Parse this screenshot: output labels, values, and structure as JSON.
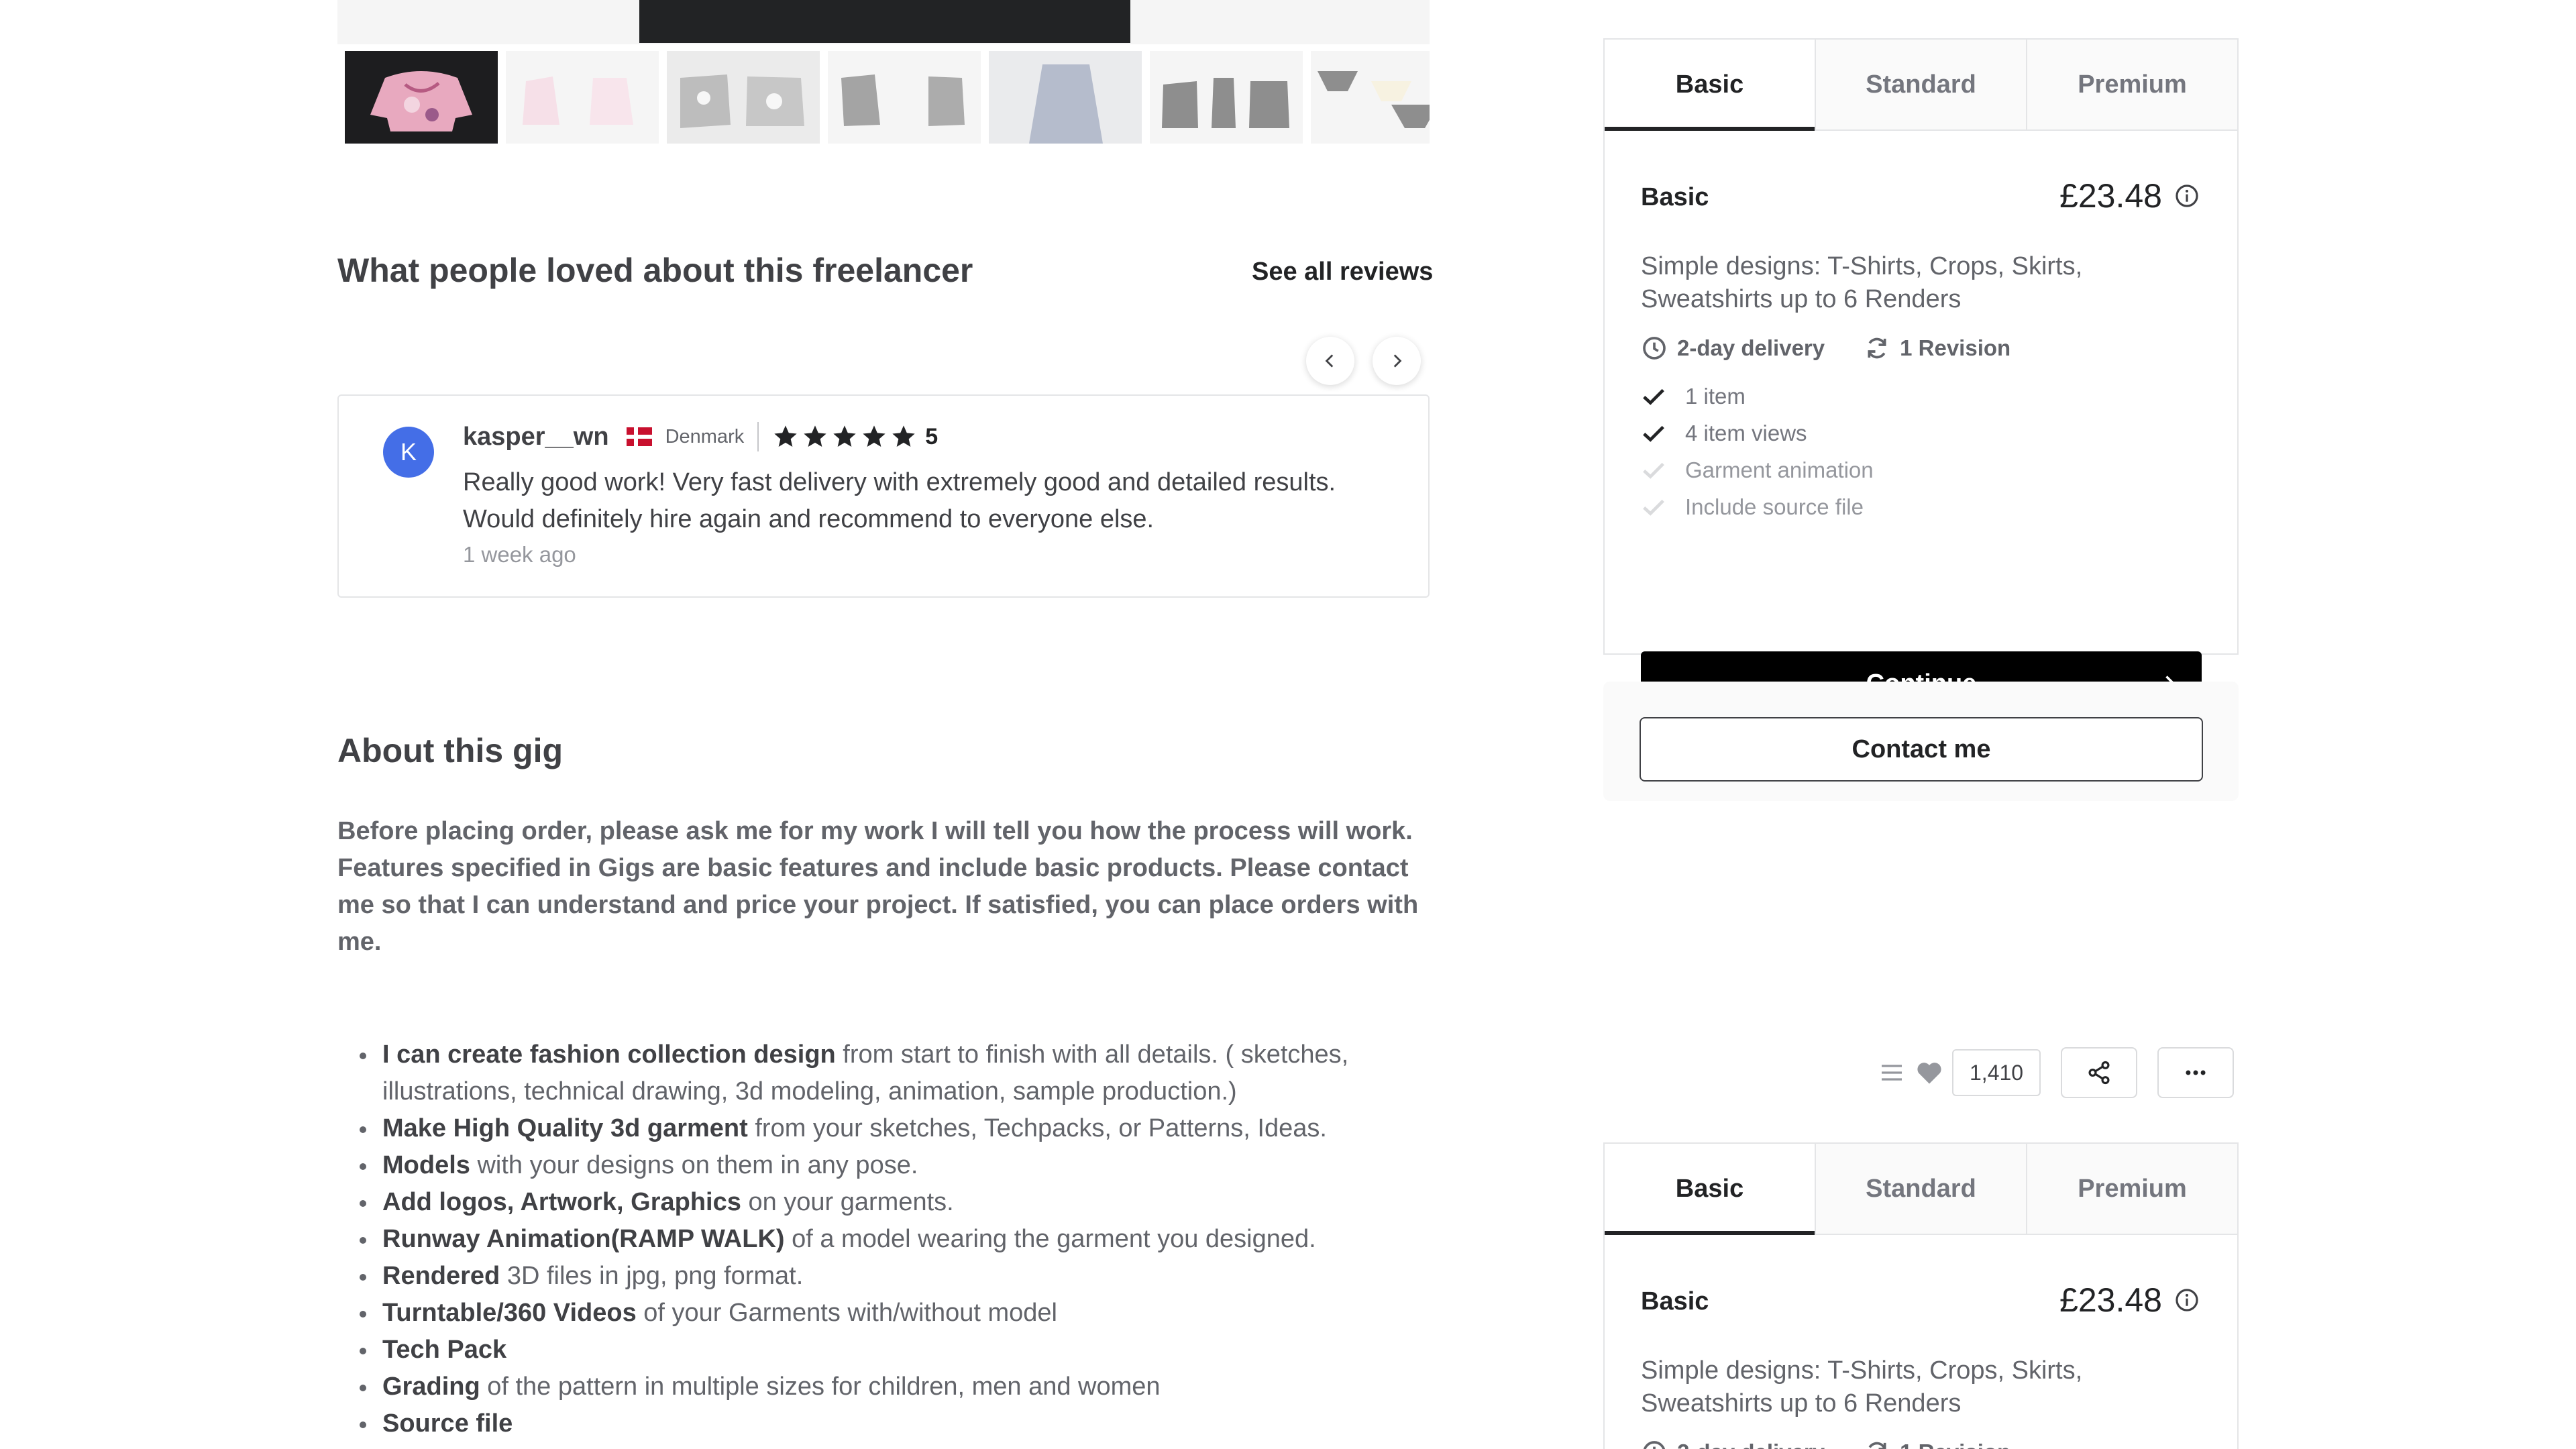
{
  "reviews": {
    "title": "What people loved about this freelancer",
    "see_all": "See all reviews",
    "review": {
      "avatar_initial": "K",
      "username": "kasper__wn",
      "country": "Denmark",
      "rating": "5",
      "text": "Really good work! Very fast delivery with extremely good and detailed results. Would definitely hire again and recommend to everyone else.",
      "time": "1 week ago"
    }
  },
  "about": {
    "title": "About this gig",
    "intro": "Before placing order, please ask me for my work I will tell you how the process will work. Features specified in Gigs are basic features and include basic products. Please contact me so that I can understand and price your project. If satisfied, you can place orders with me.",
    "items": [
      {
        "bold": "I can create fashion collection design",
        "rest": " from start to finish with all details. ( sketches, illustrations, technical drawing, 3d modeling, animation, sample production.)"
      },
      {
        "bold": "Make High Quality 3d garment",
        "rest": " from your sketches, Techpacks, or Patterns, Ideas."
      },
      {
        "bold": "Models",
        "rest": " with your designs on them in any pose."
      },
      {
        "bold": "Add logos, Artwork, Graphics",
        "rest": " on your garments."
      },
      {
        "bold": "Runway Animation(RAMP WALK)",
        "rest": " of a model wearing the garment you designed."
      },
      {
        "bold": "Rendered",
        "rest": " 3D files in jpg, png format."
      },
      {
        "bold": "Turntable/360 Videos",
        "rest": " of your Garments with/without model"
      },
      {
        "bold": "Tech Pack",
        "rest": ""
      },
      {
        "bold": "Grading",
        "rest": " of the pattern in multiple sizes for children, men and women"
      },
      {
        "bold": "Source file",
        "rest": ""
      }
    ]
  },
  "package": {
    "tabs": [
      "Basic",
      "Standard",
      "Premium"
    ],
    "name": "Basic",
    "price": "£23.48",
    "description": "Simple designs: T-Shirts, Crops, Skirts, Sweatshirts up to 6 Renders",
    "delivery": "2-day delivery",
    "revisions": "1 Revision",
    "features": [
      {
        "label": "1 item",
        "included": true
      },
      {
        "label": "4 item views",
        "included": true
      },
      {
        "label": "Garment animation",
        "included": false
      },
      {
        "label": "Include source file",
        "included": false
      }
    ],
    "continue_label": "Continue"
  },
  "contact": {
    "label": "Contact me"
  },
  "actions": {
    "likes": "1,410"
  },
  "colors": {
    "accent": "#222325",
    "avatar": "#446ee7",
    "flag": "#c8102e"
  },
  "icons": [
    "chevron-left-icon",
    "chevron-right-icon",
    "star-icon",
    "info-icon",
    "clock-icon",
    "refresh-icon",
    "check-icon",
    "arrow-right-icon",
    "list-icon",
    "heart-icon",
    "share-icon",
    "more-icon"
  ]
}
